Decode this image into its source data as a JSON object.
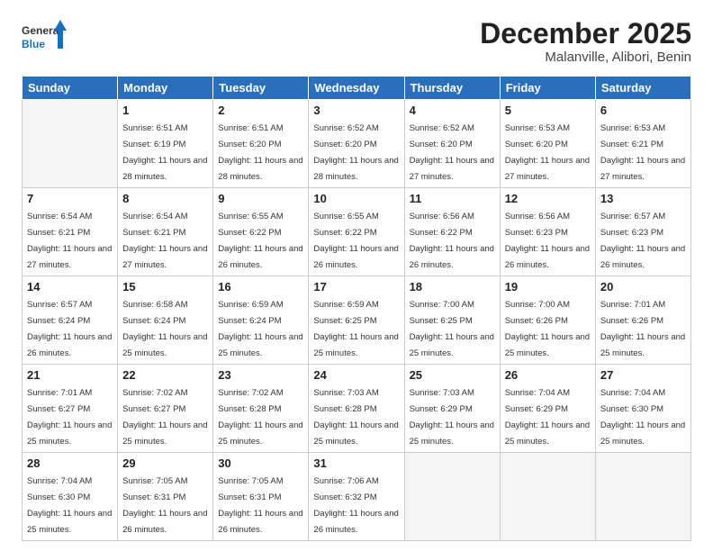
{
  "logo": {
    "general": "General",
    "blue": "Blue"
  },
  "title": {
    "month_year": "December 2025",
    "location": "Malanville, Alibori, Benin"
  },
  "weekdays": [
    "Sunday",
    "Monday",
    "Tuesday",
    "Wednesday",
    "Thursday",
    "Friday",
    "Saturday"
  ],
  "weeks": [
    [
      {
        "day": "",
        "empty": true
      },
      {
        "day": "1",
        "sunrise": "6:51 AM",
        "sunset": "6:19 PM",
        "daylight": "11 hours and 28 minutes."
      },
      {
        "day": "2",
        "sunrise": "6:51 AM",
        "sunset": "6:20 PM",
        "daylight": "11 hours and 28 minutes."
      },
      {
        "day": "3",
        "sunrise": "6:52 AM",
        "sunset": "6:20 PM",
        "daylight": "11 hours and 28 minutes."
      },
      {
        "day": "4",
        "sunrise": "6:52 AM",
        "sunset": "6:20 PM",
        "daylight": "11 hours and 27 minutes."
      },
      {
        "day": "5",
        "sunrise": "6:53 AM",
        "sunset": "6:20 PM",
        "daylight": "11 hours and 27 minutes."
      },
      {
        "day": "6",
        "sunrise": "6:53 AM",
        "sunset": "6:21 PM",
        "daylight": "11 hours and 27 minutes."
      }
    ],
    [
      {
        "day": "7",
        "sunrise": "6:54 AM",
        "sunset": "6:21 PM",
        "daylight": "11 hours and 27 minutes."
      },
      {
        "day": "8",
        "sunrise": "6:54 AM",
        "sunset": "6:21 PM",
        "daylight": "11 hours and 27 minutes."
      },
      {
        "day": "9",
        "sunrise": "6:55 AM",
        "sunset": "6:22 PM",
        "daylight": "11 hours and 26 minutes."
      },
      {
        "day": "10",
        "sunrise": "6:55 AM",
        "sunset": "6:22 PM",
        "daylight": "11 hours and 26 minutes."
      },
      {
        "day": "11",
        "sunrise": "6:56 AM",
        "sunset": "6:22 PM",
        "daylight": "11 hours and 26 minutes."
      },
      {
        "day": "12",
        "sunrise": "6:56 AM",
        "sunset": "6:23 PM",
        "daylight": "11 hours and 26 minutes."
      },
      {
        "day": "13",
        "sunrise": "6:57 AM",
        "sunset": "6:23 PM",
        "daylight": "11 hours and 26 minutes."
      }
    ],
    [
      {
        "day": "14",
        "sunrise": "6:57 AM",
        "sunset": "6:24 PM",
        "daylight": "11 hours and 26 minutes."
      },
      {
        "day": "15",
        "sunrise": "6:58 AM",
        "sunset": "6:24 PM",
        "daylight": "11 hours and 25 minutes."
      },
      {
        "day": "16",
        "sunrise": "6:59 AM",
        "sunset": "6:24 PM",
        "daylight": "11 hours and 25 minutes."
      },
      {
        "day": "17",
        "sunrise": "6:59 AM",
        "sunset": "6:25 PM",
        "daylight": "11 hours and 25 minutes."
      },
      {
        "day": "18",
        "sunrise": "7:00 AM",
        "sunset": "6:25 PM",
        "daylight": "11 hours and 25 minutes."
      },
      {
        "day": "19",
        "sunrise": "7:00 AM",
        "sunset": "6:26 PM",
        "daylight": "11 hours and 25 minutes."
      },
      {
        "day": "20",
        "sunrise": "7:01 AM",
        "sunset": "6:26 PM",
        "daylight": "11 hours and 25 minutes."
      }
    ],
    [
      {
        "day": "21",
        "sunrise": "7:01 AM",
        "sunset": "6:27 PM",
        "daylight": "11 hours and 25 minutes."
      },
      {
        "day": "22",
        "sunrise": "7:02 AM",
        "sunset": "6:27 PM",
        "daylight": "11 hours and 25 minutes."
      },
      {
        "day": "23",
        "sunrise": "7:02 AM",
        "sunset": "6:28 PM",
        "daylight": "11 hours and 25 minutes."
      },
      {
        "day": "24",
        "sunrise": "7:03 AM",
        "sunset": "6:28 PM",
        "daylight": "11 hours and 25 minutes."
      },
      {
        "day": "25",
        "sunrise": "7:03 AM",
        "sunset": "6:29 PM",
        "daylight": "11 hours and 25 minutes."
      },
      {
        "day": "26",
        "sunrise": "7:04 AM",
        "sunset": "6:29 PM",
        "daylight": "11 hours and 25 minutes."
      },
      {
        "day": "27",
        "sunrise": "7:04 AM",
        "sunset": "6:30 PM",
        "daylight": "11 hours and 25 minutes."
      }
    ],
    [
      {
        "day": "28",
        "sunrise": "7:04 AM",
        "sunset": "6:30 PM",
        "daylight": "11 hours and 25 minutes."
      },
      {
        "day": "29",
        "sunrise": "7:05 AM",
        "sunset": "6:31 PM",
        "daylight": "11 hours and 26 minutes."
      },
      {
        "day": "30",
        "sunrise": "7:05 AM",
        "sunset": "6:31 PM",
        "daylight": "11 hours and 26 minutes."
      },
      {
        "day": "31",
        "sunrise": "7:06 AM",
        "sunset": "6:32 PM",
        "daylight": "11 hours and 26 minutes."
      },
      {
        "day": "",
        "empty": true
      },
      {
        "day": "",
        "empty": true
      },
      {
        "day": "",
        "empty": true
      }
    ]
  ]
}
